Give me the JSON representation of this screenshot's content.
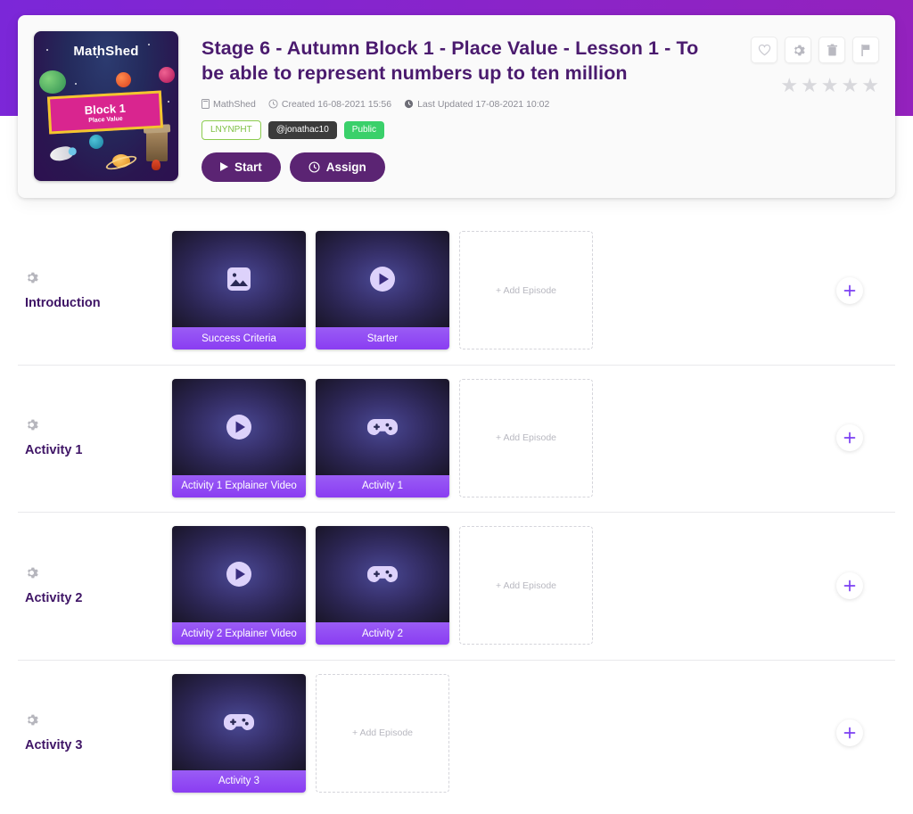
{
  "header": {
    "title": "Stage 6 - Autumn Block 1 - Place Value - Lesson 1 - To be able to represent numbers up to ten million",
    "thumbnail": {
      "brand": "MathShed",
      "banner_title": "Block 1",
      "banner_subtitle": "Place Value"
    },
    "meta": {
      "publisher": "MathShed",
      "created": "Created 16-08-2021 15:56",
      "updated": "Last Updated 17-08-2021 10:02"
    },
    "tags": {
      "code": "LNYNPHT",
      "user": "@jonathac10",
      "visibility": "Public"
    },
    "buttons": {
      "start": "Start",
      "assign": "Assign"
    },
    "icon_buttons": [
      {
        "name": "favourite-icon",
        "title": "Favourite"
      },
      {
        "name": "settings-icon",
        "title": "Settings"
      },
      {
        "name": "delete-icon",
        "title": "Delete"
      },
      {
        "name": "report-icon",
        "title": "Report"
      }
    ],
    "rating": {
      "stars": 5,
      "filled": 0,
      "color": "#d8d8dc"
    }
  },
  "add_episode_label": "+ Add Episode",
  "rows": [
    {
      "title": "Introduction",
      "cards": [
        {
          "label": "Success Criteria",
          "icon": "image-icon"
        },
        {
          "label": "Starter",
          "icon": "play-icon"
        }
      ]
    },
    {
      "title": "Activity 1",
      "cards": [
        {
          "label": "Activity 1 Explainer Video",
          "icon": "play-icon"
        },
        {
          "label": "Activity 1",
          "icon": "gamepad-icon"
        }
      ]
    },
    {
      "title": "Activity 2",
      "cards": [
        {
          "label": "Activity 2 Explainer Video",
          "icon": "play-icon"
        },
        {
          "label": "Activity 2",
          "icon": "gamepad-icon"
        }
      ]
    },
    {
      "title": "Activity 3",
      "cards": [
        {
          "label": "Activity 3",
          "icon": "gamepad-icon"
        }
      ]
    }
  ],
  "colors": {
    "band_start": "#7b27d8",
    "band_end": "#9422bd",
    "title": "#4a1a6e",
    "button": "#5b2473",
    "card_label": "#8a3df2",
    "accent_plus": "#7b3ff2"
  }
}
